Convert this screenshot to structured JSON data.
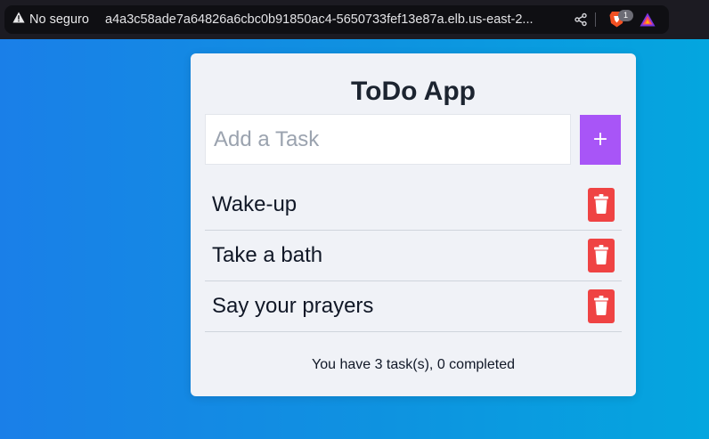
{
  "browser": {
    "security_label": "No seguro",
    "url": "a4a3c58ade7a64826a6cbc0b91850ac4-5650733fef13e87a.elb.us-east-2...",
    "shields_count": "1",
    "icons": [
      "warning-icon",
      "share-icon",
      "brave-shields-icon",
      "brave-rewards-icon"
    ]
  },
  "app": {
    "title": "ToDo App",
    "input_placeholder": "Add a Task",
    "input_value": "",
    "add_button_label": "+",
    "tasks": [
      {
        "label": "Wake-up",
        "completed": false
      },
      {
        "label": "Take a bath",
        "completed": false
      },
      {
        "label": "Say your prayers",
        "completed": false
      }
    ],
    "delete_icon": "trash-icon",
    "summary": "You have 3 task(s), 0 completed"
  },
  "colors": {
    "add_button": "#a855f7",
    "delete_button": "#ef4343",
    "background_start": "#1a7fe8",
    "background_end": "#04a6df"
  }
}
